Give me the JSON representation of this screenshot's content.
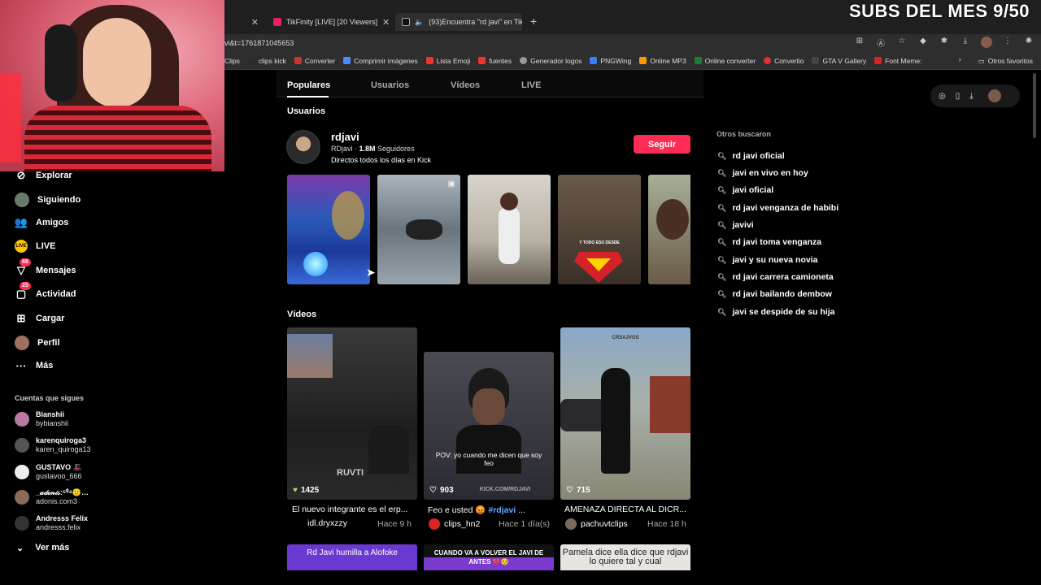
{
  "overlay": {
    "subs": "SUBS DEL MES 9/50"
  },
  "browser": {
    "tabs": [
      {
        "label": "TikFinity [LIVE] [20 Viewers]"
      },
      {
        "label": "(93)Encuentra \"rd javi\" en Tik"
      }
    ],
    "url": "vi&t=1761871045653",
    "bookmarks": [
      "Clips",
      "clips kick",
      "Converter",
      "Comprimir imágenes",
      "Lista Emoji",
      "fuentes",
      "Generador logos",
      "PNGWing",
      "Online MP3",
      "Online converter",
      "Convertio",
      "GTA V Gallery",
      "Font Meme:"
    ],
    "other_bookmarks": "Otros favoritos"
  },
  "nav": {
    "explore": "Explorar",
    "following": "Siguiendo",
    "friends": "Amigos",
    "live": "LIVE",
    "messages": "Mensajes",
    "messages_badge": "68",
    "activity": "Actividad",
    "activity_badge": "25",
    "upload": "Cargar",
    "profile": "Perfil",
    "more": "Más",
    "live_icon_text": "LIVE"
  },
  "following": {
    "title": "Cuentas que sigues",
    "accounts": [
      {
        "name": "Bianshii",
        "handle": "bybianshii",
        "color": "#b87aa0"
      },
      {
        "name": "karenquiroga3",
        "handle": "karen_quiroga13",
        "color": "#555555"
      },
      {
        "name": "GUSTAVO 🎩",
        "handle": "gustavoo_666",
        "color": "#eeeeee"
      },
      {
        "name": "_𝒶𝒹ℴ𝓃𝒾𝓈:⁵⁰⁴🙂…",
        "handle": "adonis.com3",
        "color": "#8a6a5a"
      },
      {
        "name": "Andresss Felix",
        "handle": "andresss.felix",
        "color": "#333333"
      }
    ],
    "see_more": "Ver más"
  },
  "search_tabs": [
    "Populares",
    "Usuarios",
    "Vídeos",
    "LIVE"
  ],
  "users_section": {
    "title": "Usuarios",
    "user": {
      "name": "rdjavi",
      "nick": "RDjavi · ",
      "followers": "1.8M",
      "followers_label": " Seguidores",
      "bio": "Directos todos los días en Kick",
      "follow_button": "Seguir"
    },
    "thumb_captions": [
      "",
      "",
      "",
      "Y TODO ESO DESDE",
      ""
    ]
  },
  "videos_section": {
    "title": "Vídeos",
    "videos": [
      {
        "likes": "1425",
        "overlay": "RUVTI",
        "desc": "El nuevo integrante es el erp...",
        "author": "idl.dryxzzy",
        "time": "Hace 9 h"
      },
      {
        "likes": "903",
        "overlay": "POV: yo cuando me dicen que soy feo",
        "watermark": "KICK.COM/RDJAVI",
        "desc": "Feo e usted 😡 ",
        "tag": "#rdjavi",
        "desc_end": " ...",
        "author": "clips_hn2",
        "time": "Hace 1 día(s)"
      },
      {
        "likes": "715",
        "overlay": "CRSAJVOS",
        "desc": "AMENAZA DIRECTA AL DICR...",
        "author": "pachuvtclips",
        "time": "Hace 18 h"
      }
    ],
    "bottom_thumbs": [
      "Rd Javi humilla a Alofoke",
      "CUANDO VA A VOLVER EL JAVI DE ANTES 💔🥺",
      "Pamela dice ella dice que rdjavi lo quiere tal y cual"
    ]
  },
  "others_searched": {
    "title": "Otros buscaron",
    "items": [
      "rd javi oficial",
      "javi en vivo en hoy",
      "javi oficial",
      "rd javi venganza de habibi",
      "javivi",
      "rd javi toma venganza",
      "javi y su nueva novia",
      "rd javi carrera camioneta",
      "rd javi bailando dembow",
      "javi se despide de su hija"
    ]
  },
  "colors": {
    "accent": "#fe2c55",
    "badge": "#fe2c55",
    "live": "#ffc400"
  }
}
